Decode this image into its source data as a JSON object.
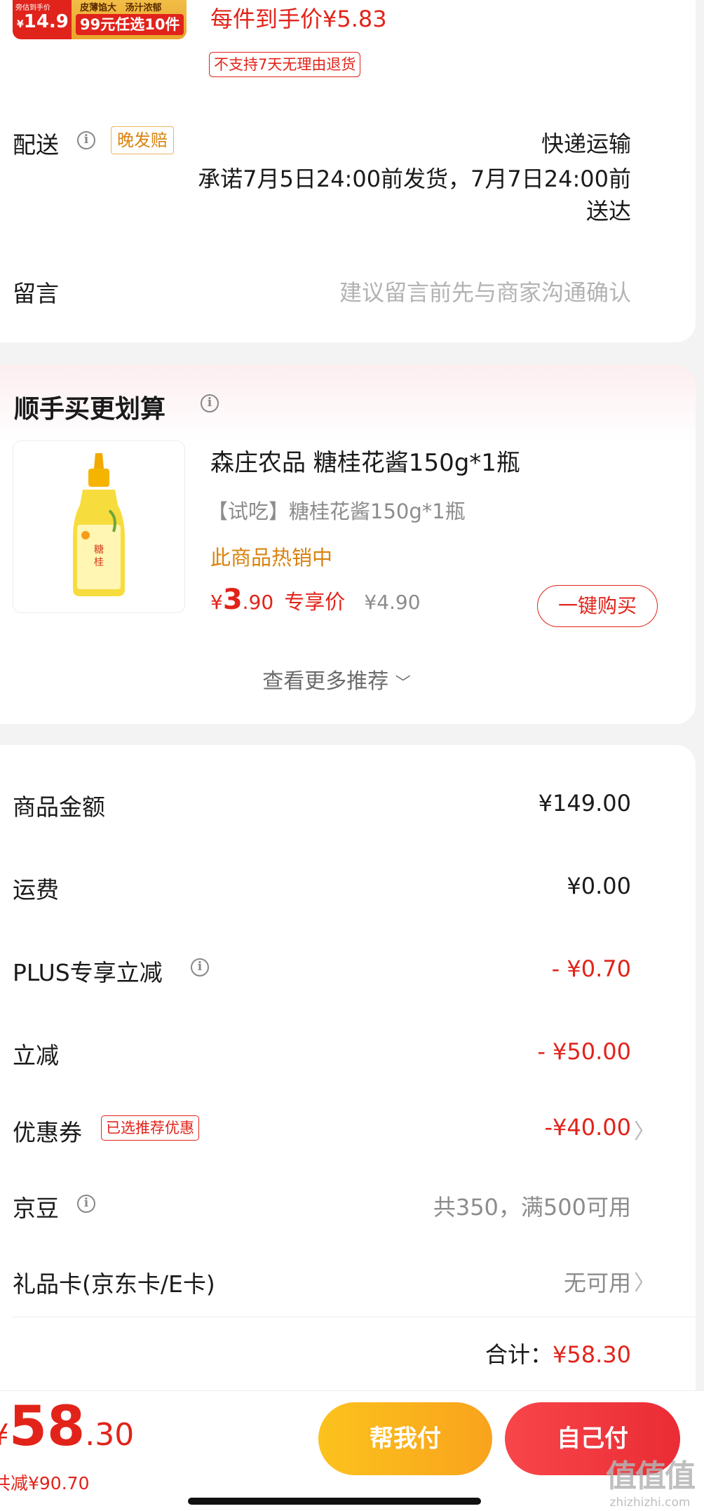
{
  "top_item": {
    "thumb_badge_left": "旁估到手价",
    "thumb_price_sym": "¥",
    "thumb_price": "14.9",
    "thumb_tag1": "皮薄馅大",
    "thumb_tag2": "汤汁浓郁",
    "thumb_promo": "99元任选10件",
    "unit_price": "每件到手价¥5.83",
    "return_policy": "不支持7天无理由退货"
  },
  "delivery": {
    "label": "配送",
    "late_badge": "晚发赔",
    "method": "快递运输",
    "promise": "承诺7月5日24:00前发货，7月7日24:00前送达"
  },
  "message": {
    "label": "留言",
    "placeholder": "建议留言前先与商家沟通确认"
  },
  "addon": {
    "title": "顺手买更划算",
    "product_name": "森庄农品 糖桂花酱150g*1瓶",
    "product_subtitle": "【试吃】糖桂花酱150g*1瓶",
    "hot_label": "此商品热销中",
    "price_sym": "¥",
    "price_int": "3",
    "price_dec": ".90",
    "price_tag": "专享价",
    "original_price": "¥4.90",
    "buy_button": "一键购买",
    "more_label": "查看更多推荐"
  },
  "summary": {
    "rows": [
      {
        "label": "商品金额",
        "value": "¥149.00"
      },
      {
        "label": "运费",
        "value": "¥0.00"
      },
      {
        "label": "PLUS专享立减",
        "value": "- ¥0.70"
      },
      {
        "label": "立减",
        "value": "- ¥50.00"
      },
      {
        "label": "优惠券",
        "badge": "已选推荐优惠",
        "value": "-¥40.00"
      },
      {
        "label": "京豆",
        "value": "共350，满500可用"
      },
      {
        "label": "礼品卡(京东卡/E卡)",
        "value": "无可用"
      }
    ],
    "total_label": "合计：",
    "total_value": "¥58.30"
  },
  "bottom_bar": {
    "price_sym": "¥",
    "price_int": "58",
    "price_dec": ".30",
    "saved": "共减¥90.70",
    "help_pay": "帮我付",
    "self_pay": "自己付"
  },
  "watermark": {
    "text": "值值值",
    "url": "zhizhizhi.com"
  },
  "colors": {
    "accent_red": "#e2231a",
    "help_pay_yellow": "#fbb01f",
    "self_pay_red": "#f2353b",
    "hot_orange": "#d9830f"
  }
}
